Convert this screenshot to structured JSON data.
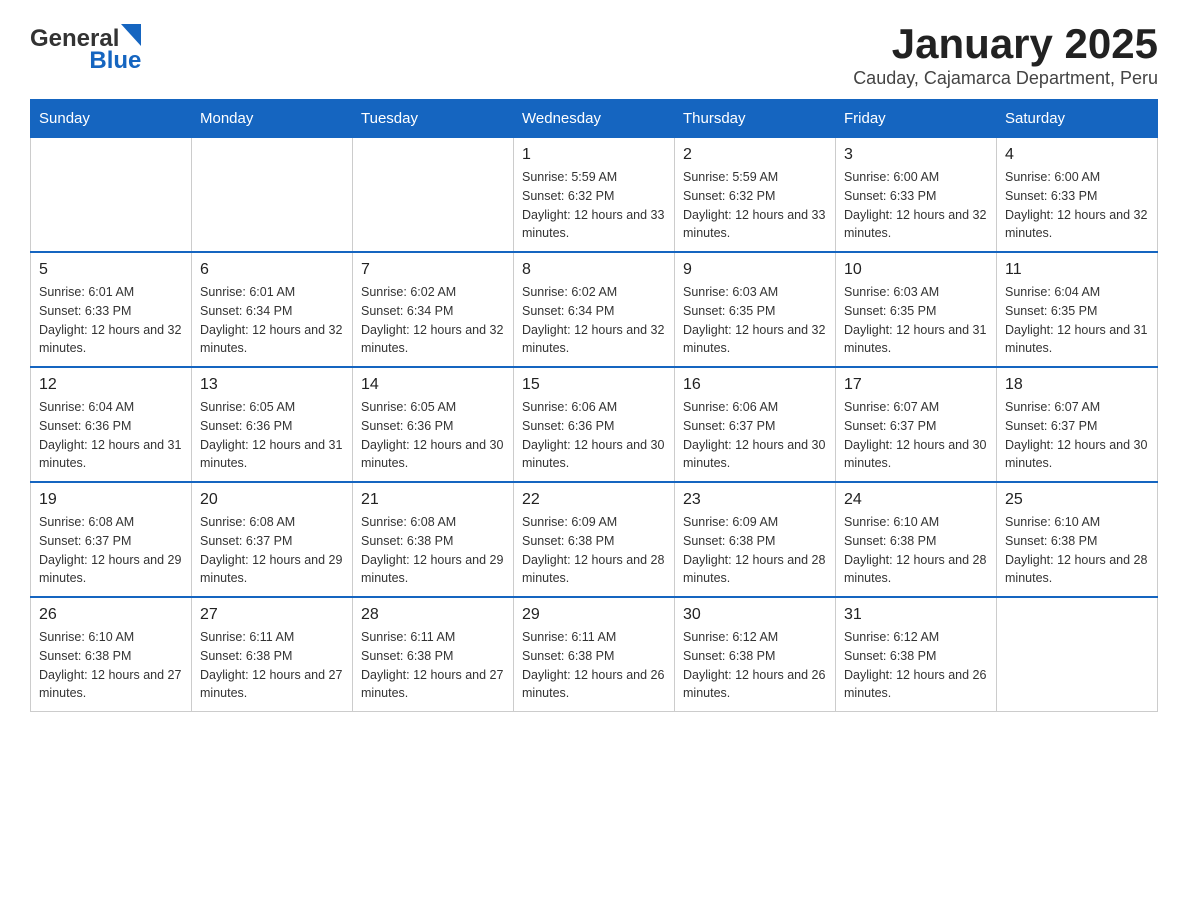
{
  "header": {
    "logo_general": "General",
    "logo_blue": "Blue",
    "title": "January 2025",
    "subtitle": "Cauday, Cajamarca Department, Peru"
  },
  "weekdays": [
    "Sunday",
    "Monday",
    "Tuesday",
    "Wednesday",
    "Thursday",
    "Friday",
    "Saturday"
  ],
  "weeks": [
    [
      {
        "day": "",
        "info": ""
      },
      {
        "day": "",
        "info": ""
      },
      {
        "day": "",
        "info": ""
      },
      {
        "day": "1",
        "info": "Sunrise: 5:59 AM\nSunset: 6:32 PM\nDaylight: 12 hours and 33 minutes."
      },
      {
        "day": "2",
        "info": "Sunrise: 5:59 AM\nSunset: 6:32 PM\nDaylight: 12 hours and 33 minutes."
      },
      {
        "day": "3",
        "info": "Sunrise: 6:00 AM\nSunset: 6:33 PM\nDaylight: 12 hours and 32 minutes."
      },
      {
        "day": "4",
        "info": "Sunrise: 6:00 AM\nSunset: 6:33 PM\nDaylight: 12 hours and 32 minutes."
      }
    ],
    [
      {
        "day": "5",
        "info": "Sunrise: 6:01 AM\nSunset: 6:33 PM\nDaylight: 12 hours and 32 minutes."
      },
      {
        "day": "6",
        "info": "Sunrise: 6:01 AM\nSunset: 6:34 PM\nDaylight: 12 hours and 32 minutes."
      },
      {
        "day": "7",
        "info": "Sunrise: 6:02 AM\nSunset: 6:34 PM\nDaylight: 12 hours and 32 minutes."
      },
      {
        "day": "8",
        "info": "Sunrise: 6:02 AM\nSunset: 6:34 PM\nDaylight: 12 hours and 32 minutes."
      },
      {
        "day": "9",
        "info": "Sunrise: 6:03 AM\nSunset: 6:35 PM\nDaylight: 12 hours and 32 minutes."
      },
      {
        "day": "10",
        "info": "Sunrise: 6:03 AM\nSunset: 6:35 PM\nDaylight: 12 hours and 31 minutes."
      },
      {
        "day": "11",
        "info": "Sunrise: 6:04 AM\nSunset: 6:35 PM\nDaylight: 12 hours and 31 minutes."
      }
    ],
    [
      {
        "day": "12",
        "info": "Sunrise: 6:04 AM\nSunset: 6:36 PM\nDaylight: 12 hours and 31 minutes."
      },
      {
        "day": "13",
        "info": "Sunrise: 6:05 AM\nSunset: 6:36 PM\nDaylight: 12 hours and 31 minutes."
      },
      {
        "day": "14",
        "info": "Sunrise: 6:05 AM\nSunset: 6:36 PM\nDaylight: 12 hours and 30 minutes."
      },
      {
        "day": "15",
        "info": "Sunrise: 6:06 AM\nSunset: 6:36 PM\nDaylight: 12 hours and 30 minutes."
      },
      {
        "day": "16",
        "info": "Sunrise: 6:06 AM\nSunset: 6:37 PM\nDaylight: 12 hours and 30 minutes."
      },
      {
        "day": "17",
        "info": "Sunrise: 6:07 AM\nSunset: 6:37 PM\nDaylight: 12 hours and 30 minutes."
      },
      {
        "day": "18",
        "info": "Sunrise: 6:07 AM\nSunset: 6:37 PM\nDaylight: 12 hours and 30 minutes."
      }
    ],
    [
      {
        "day": "19",
        "info": "Sunrise: 6:08 AM\nSunset: 6:37 PM\nDaylight: 12 hours and 29 minutes."
      },
      {
        "day": "20",
        "info": "Sunrise: 6:08 AM\nSunset: 6:37 PM\nDaylight: 12 hours and 29 minutes."
      },
      {
        "day": "21",
        "info": "Sunrise: 6:08 AM\nSunset: 6:38 PM\nDaylight: 12 hours and 29 minutes."
      },
      {
        "day": "22",
        "info": "Sunrise: 6:09 AM\nSunset: 6:38 PM\nDaylight: 12 hours and 28 minutes."
      },
      {
        "day": "23",
        "info": "Sunrise: 6:09 AM\nSunset: 6:38 PM\nDaylight: 12 hours and 28 minutes."
      },
      {
        "day": "24",
        "info": "Sunrise: 6:10 AM\nSunset: 6:38 PM\nDaylight: 12 hours and 28 minutes."
      },
      {
        "day": "25",
        "info": "Sunrise: 6:10 AM\nSunset: 6:38 PM\nDaylight: 12 hours and 28 minutes."
      }
    ],
    [
      {
        "day": "26",
        "info": "Sunrise: 6:10 AM\nSunset: 6:38 PM\nDaylight: 12 hours and 27 minutes."
      },
      {
        "day": "27",
        "info": "Sunrise: 6:11 AM\nSunset: 6:38 PM\nDaylight: 12 hours and 27 minutes."
      },
      {
        "day": "28",
        "info": "Sunrise: 6:11 AM\nSunset: 6:38 PM\nDaylight: 12 hours and 27 minutes."
      },
      {
        "day": "29",
        "info": "Sunrise: 6:11 AM\nSunset: 6:38 PM\nDaylight: 12 hours and 26 minutes."
      },
      {
        "day": "30",
        "info": "Sunrise: 6:12 AM\nSunset: 6:38 PM\nDaylight: 12 hours and 26 minutes."
      },
      {
        "day": "31",
        "info": "Sunrise: 6:12 AM\nSunset: 6:38 PM\nDaylight: 12 hours and 26 minutes."
      },
      {
        "day": "",
        "info": ""
      }
    ]
  ]
}
